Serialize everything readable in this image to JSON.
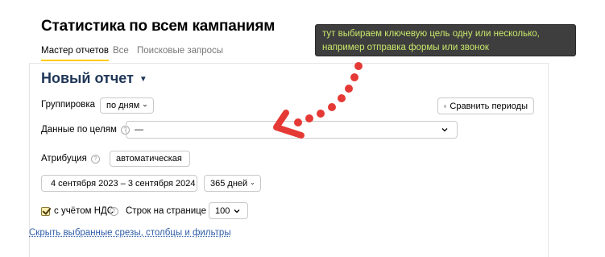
{
  "page_title": "Статистика по всем кампаниям",
  "tabs": [
    {
      "label": "Мастер отчетов",
      "active": true
    },
    {
      "label": "Все",
      "active": false
    },
    {
      "label": "Поисковые запросы",
      "active": false
    }
  ],
  "report": {
    "title": "Новый отчет"
  },
  "grouping": {
    "label": "Группировка",
    "value": "по дням"
  },
  "compare_periods": {
    "label": "Сравнить периоды"
  },
  "goals": {
    "label": "Данные по целям",
    "value": "—"
  },
  "attribution": {
    "label": "Атрибуция",
    "value": "автоматическая"
  },
  "date_range": {
    "value": "4 сентября 2023 – 3 сентября 2024"
  },
  "period_length": {
    "value": "365 дней"
  },
  "vat": {
    "label": "с учётом НДС",
    "checked": true
  },
  "rows_per_page": {
    "label": "Строк на странице",
    "value": "100"
  },
  "hide_link": {
    "label": "Скрыть выбранные срезы, столбцы и фильтры"
  },
  "annotation": {
    "line1": "тут выбираем ключевую цель одну или несколько,",
    "line2": "например отправка формы или звонок",
    "text_color": "#c8e86a",
    "background": "#3e3e3e",
    "arrow_color": "#e53935"
  }
}
